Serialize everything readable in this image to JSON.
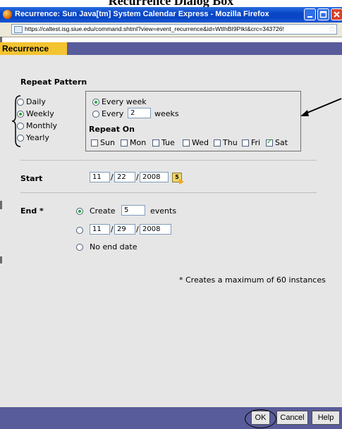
{
  "figure_title": "Recurrence Dialog Box",
  "window": {
    "title": "Recurrence: Sun Java[tm] System Calendar Express - Mozilla Firefox",
    "url": "https://caltest.isg.siue.edu/command.shtml?view=event_recurrence&id=WtIhBI9PIkI&crc=343726!"
  },
  "dialog": {
    "tab_label": "Recurrence"
  },
  "repeat_pattern": {
    "heading": "Repeat Pattern",
    "frequency_options": [
      {
        "label": "Daily",
        "selected": false
      },
      {
        "label": "Weekly",
        "selected": true
      },
      {
        "label": "Monthly",
        "selected": false
      },
      {
        "label": "Yearly",
        "selected": false
      }
    ],
    "every_week_label": "Every week",
    "every_prefix": "Every",
    "every_value": "2",
    "every_suffix": "weeks",
    "repeat_on_label": "Repeat On",
    "days": [
      {
        "label": "Sun",
        "checked": false
      },
      {
        "label": "Mon",
        "checked": false
      },
      {
        "label": "Tue",
        "checked": false
      },
      {
        "label": "Wed",
        "checked": false
      },
      {
        "label": "Thu",
        "checked": false
      },
      {
        "label": "Fri",
        "checked": false
      },
      {
        "label": "Sat",
        "checked": true
      }
    ]
  },
  "start": {
    "label": "Start",
    "month": "11",
    "day": "22",
    "year": "2008",
    "calendar_icon": "calendar-picker-icon"
  },
  "end": {
    "label": "End *",
    "create_label": "Create",
    "count_value": "5",
    "events_label": "events",
    "month": "11",
    "day": "29",
    "year": "2008",
    "no_end_label": "No end date"
  },
  "note": "* Creates a maximum of 60 instances",
  "buttons": {
    "ok": "OK",
    "cancel": "Cancel",
    "help": "Help"
  },
  "colors": {
    "titlebar": "#0846c6",
    "dialog_bar": "#595c9a",
    "tab": "#f3c431",
    "panel": "#e6e6e6",
    "radio_dot": "#1fa82b"
  }
}
